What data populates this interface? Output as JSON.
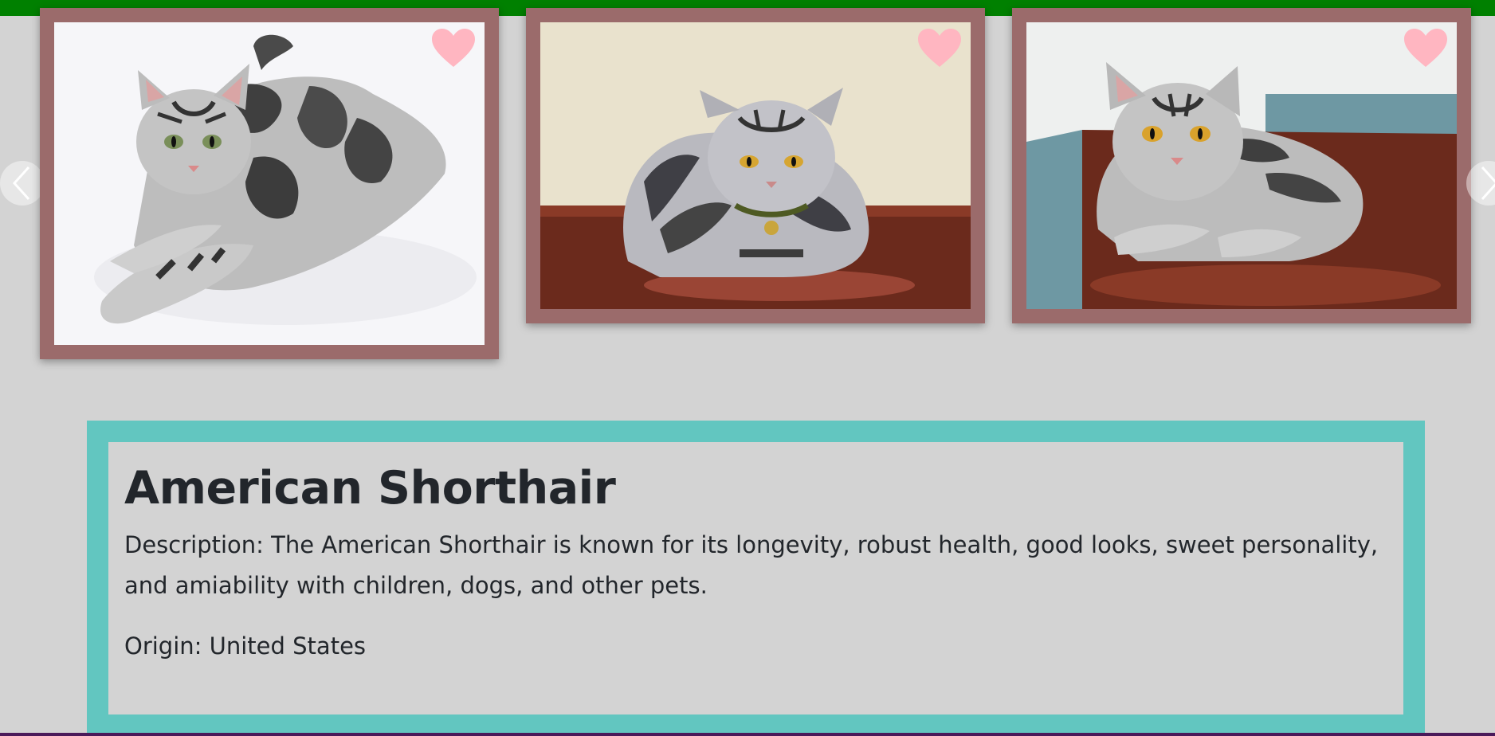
{
  "colors": {
    "top_bar": "#008000",
    "background": "#d3d3d3",
    "card_frame": "#9b6b6b",
    "info_border": "#62c6c0",
    "heart": "#ffb6c1",
    "text": "#22262b"
  },
  "carousel": {
    "prev_icon": "chevron-left-icon",
    "next_icon": "chevron-right-icon",
    "cards": [
      {
        "image_label": "cat-photo",
        "favorite_icon": "heart-icon"
      },
      {
        "image_label": "cat-photo",
        "favorite_icon": "heart-icon"
      },
      {
        "image_label": "cat-photo",
        "favorite_icon": "heart-icon"
      }
    ]
  },
  "breed": {
    "name": "American Shorthair",
    "description_line1": "Description: The American Shorthair is known for its longevity, robust health, good looks, sweet personality,",
    "description_line2": "and amiability with children, dogs, and other pets.",
    "origin": "Origin: United States"
  }
}
